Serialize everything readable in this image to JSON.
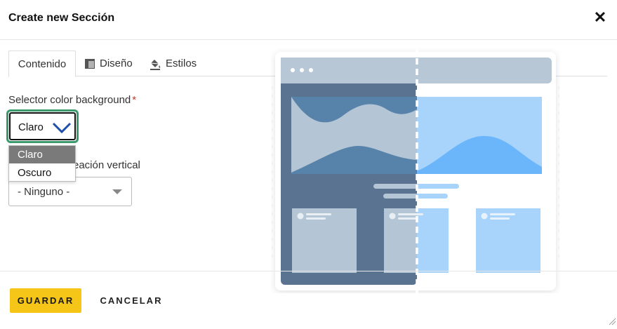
{
  "dialog": {
    "title": "Create new Sección",
    "close_icon": "close-icon",
    "close_glyph": "✕"
  },
  "tabs": [
    {
      "label": "Contenido",
      "active": true
    },
    {
      "label": "Diseño",
      "icon": "layout-icon",
      "active": false
    },
    {
      "label": "Estilos",
      "icon": "paint-bucket-icon",
      "active": false
    }
  ],
  "form": {
    "color_field": {
      "label": "Selector color background",
      "required_mark": "*",
      "value": "Claro",
      "options": [
        "Claro",
        "Oscuro"
      ],
      "selected_index": 0
    },
    "alignment_field": {
      "label_visible": "eación vertical",
      "value": "- Ninguno -"
    }
  },
  "footer": {
    "save_label": "GUARDAR",
    "cancel_label": "CANCELAR"
  },
  "colors": {
    "accent_yellow": "#f5c518",
    "focus_green": "#3a9a6b",
    "chevron_blue": "#1e4fa8",
    "dark_panel": "#5a7390",
    "light_panel": "#a8d4fc"
  }
}
